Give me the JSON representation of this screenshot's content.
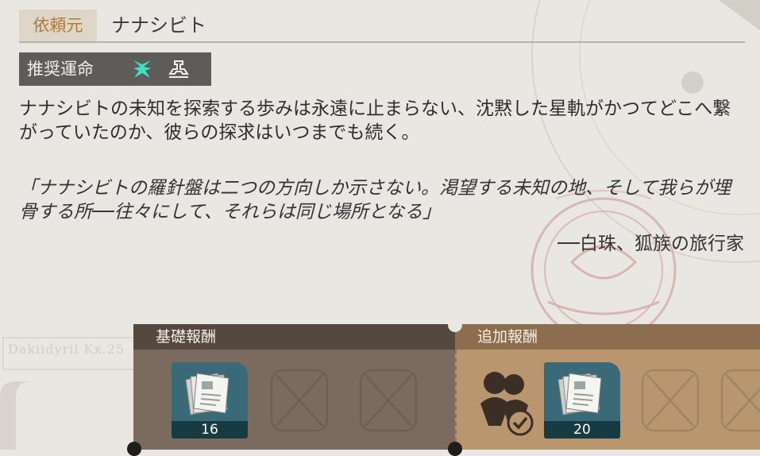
{
  "client": {
    "tag": "依頼元",
    "name": "ナナシビト"
  },
  "recommended_path": {
    "label": "推奨運命",
    "icons": [
      "nihility-path-icon",
      "preservation-path-icon"
    ],
    "colors": {
      "first": "#3fe0c0",
      "second": "#f2f2f2"
    }
  },
  "description": "ナナシビトの未知を探索する歩みは永遠に止まらない、沈黙した星軌がかつてどこへ繋がっていたのか、彼らの探求はいつまでも続く。",
  "quote": {
    "text": "「ナナシビトの羅針盤は二つの方向しか示さない。渇望する未知の地、そして我らが埋骨する所──往々にして、それらは同じ場所となる」",
    "attribution": "──白珠、狐族の旅行家"
  },
  "stamp_text": "Dakiidyrii Kx.25",
  "rewards": {
    "basic": {
      "title": "基礎報酬",
      "item": {
        "icon": "documents-icon",
        "count": "16"
      }
    },
    "extra": {
      "title": "追加報酬",
      "item": {
        "icon": "documents-icon",
        "count": "20"
      },
      "badge_icon": "crew-check-icon"
    }
  },
  "colors": {
    "background": "#e9e7e2",
    "basic_panel": "#7a6b5e",
    "extra_panel": "#b9966d",
    "item_bg": "#3a6a78",
    "client_tag": "#b07a3a"
  }
}
